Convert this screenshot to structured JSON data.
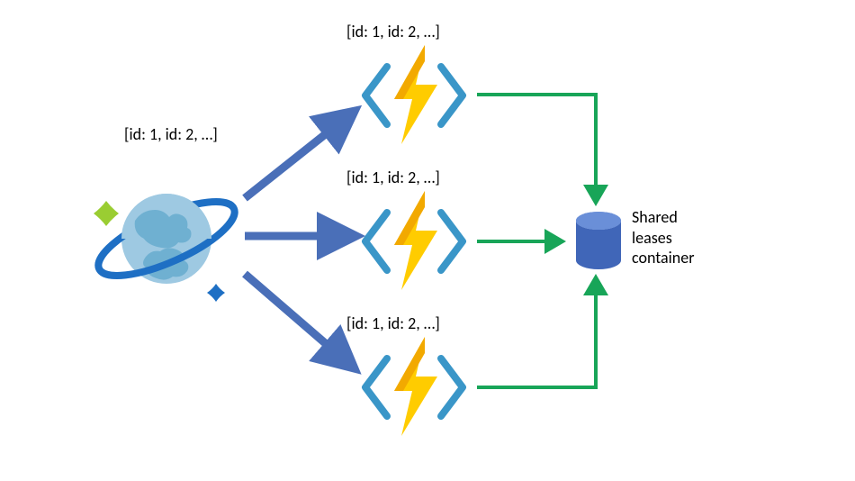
{
  "source": {
    "label": "[id: 1, id: 2, …]"
  },
  "functions": [
    {
      "label": "[id: 1, id: 2, …]"
    },
    {
      "label": "[id: 1, id: 2, …]"
    },
    {
      "label": "[id: 1, id: 2, …]"
    }
  ],
  "database": {
    "label_line1": "Shared",
    "label_line2": "leases",
    "label_line3": "container"
  }
}
